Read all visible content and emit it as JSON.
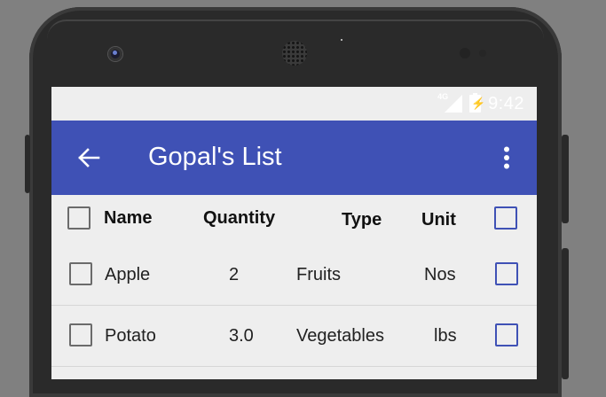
{
  "status_bar": {
    "network_label": "4G",
    "time": "9:42"
  },
  "app_bar": {
    "title": "Gopal's List",
    "back_icon": "arrow-left-icon",
    "menu_icon": "more-vert-icon"
  },
  "table": {
    "columns": [
      "Name",
      "Quantity",
      "Type",
      "Unit"
    ],
    "rows": [
      {
        "name": "Apple",
        "quantity": "2",
        "type": "Fruits",
        "unit": "Nos",
        "checked": false,
        "selected": false
      },
      {
        "name": "Potato",
        "quantity": "3.0",
        "type": "Vegetables",
        "unit": "lbs",
        "checked": false,
        "selected": false
      }
    ]
  },
  "colors": {
    "primary": "#3f51b5",
    "background": "#eeeeee",
    "checkbox_grey": "#6b6b6b"
  }
}
